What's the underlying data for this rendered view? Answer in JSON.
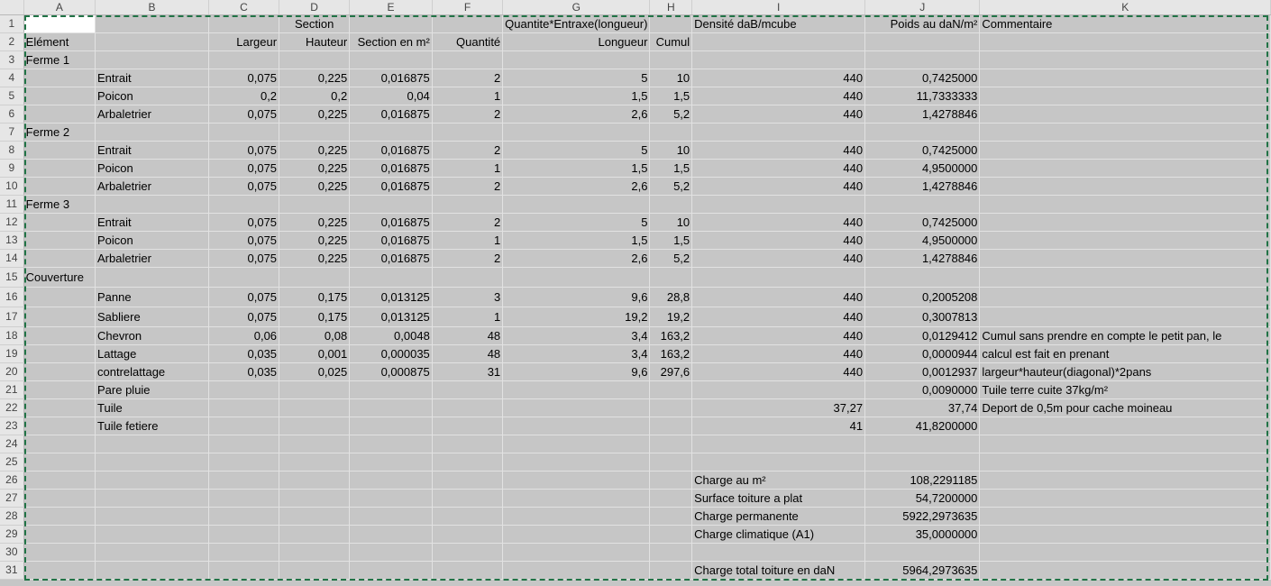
{
  "columns": [
    "A",
    "B",
    "C",
    "D",
    "E",
    "F",
    "G",
    "H",
    "I",
    "J",
    "K"
  ],
  "rows": [
    {
      "n": "1",
      "A": "",
      "B": "",
      "C": "",
      "D": "Section",
      "E": "",
      "F": "",
      "G": "Quantite*Entraxe(longueur)",
      "H": "",
      "I": "Densité daB/mcube",
      "J": "Poids au daN/m²",
      "K": "Commentaire"
    },
    {
      "n": "2",
      "A": "Elément",
      "B": "",
      "C": "Largeur",
      "D": "Hauteur",
      "E": "Section en m²",
      "F": "Quantité",
      "G": "Longueur",
      "H": "Cumul",
      "I": "",
      "J": "",
      "K": ""
    },
    {
      "n": "3",
      "A": "Ferme 1",
      "B": "",
      "C": "",
      "D": "",
      "E": "",
      "F": "",
      "G": "",
      "H": "",
      "I": "",
      "J": "",
      "K": ""
    },
    {
      "n": "4",
      "A": "",
      "B": "Entrait",
      "C": "0,075",
      "D": "0,225",
      "E": "0,016875",
      "F": "2",
      "G": "5",
      "H": "10",
      "I": "440",
      "J": "0,7425000",
      "K": ""
    },
    {
      "n": "5",
      "A": "",
      "B": "Poicon",
      "C": "0,2",
      "D": "0,2",
      "E": "0,04",
      "F": "1",
      "G": "1,5",
      "H": "1,5",
      "I": "440",
      "J": "11,7333333",
      "K": ""
    },
    {
      "n": "6",
      "A": "",
      "B": "Arbaletrier",
      "C": "0,075",
      "D": "0,225",
      "E": "0,016875",
      "F": "2",
      "G": "2,6",
      "H": "5,2",
      "I": "440",
      "J": "1,4278846",
      "K": ""
    },
    {
      "n": "7",
      "A": "Ferme 2",
      "B": "",
      "C": "",
      "D": "",
      "E": "",
      "F": "",
      "G": "",
      "H": "",
      "I": "",
      "J": "",
      "K": ""
    },
    {
      "n": "8",
      "A": "",
      "B": "Entrait",
      "C": "0,075",
      "D": "0,225",
      "E": "0,016875",
      "F": "2",
      "G": "5",
      "H": "10",
      "I": "440",
      "J": "0,7425000",
      "K": ""
    },
    {
      "n": "9",
      "A": "",
      "B": "Poicon",
      "C": "0,075",
      "D": "0,225",
      "E": "0,016875",
      "F": "1",
      "G": "1,5",
      "H": "1,5",
      "I": "440",
      "J": "4,9500000",
      "K": ""
    },
    {
      "n": "10",
      "A": "",
      "B": "Arbaletrier",
      "C": "0,075",
      "D": "0,225",
      "E": "0,016875",
      "F": "2",
      "G": "2,6",
      "H": "5,2",
      "I": "440",
      "J": "1,4278846",
      "K": ""
    },
    {
      "n": "11",
      "A": "Ferme 3",
      "B": "",
      "C": "",
      "D": "",
      "E": "",
      "F": "",
      "G": "",
      "H": "",
      "I": "",
      "J": "",
      "K": ""
    },
    {
      "n": "12",
      "A": "",
      "B": "Entrait",
      "C": "0,075",
      "D": "0,225",
      "E": "0,016875",
      "F": "2",
      "G": "5",
      "H": "10",
      "I": "440",
      "J": "0,7425000",
      "K": ""
    },
    {
      "n": "13",
      "A": "",
      "B": "Poicon",
      "C": "0,075",
      "D": "0,225",
      "E": "0,016875",
      "F": "1",
      "G": "1,5",
      "H": "1,5",
      "I": "440",
      "J": "4,9500000",
      "K": ""
    },
    {
      "n": "14",
      "A": "",
      "B": "Arbaletrier",
      "C": "0,075",
      "D": "0,225",
      "E": "0,016875",
      "F": "2",
      "G": "2,6",
      "H": "5,2",
      "I": "440",
      "J": "1,4278846",
      "K": ""
    },
    {
      "n": "15",
      "A": "Couverture",
      "B": "",
      "C": "",
      "D": "",
      "E": "",
      "F": "",
      "G": "",
      "H": "",
      "I": "",
      "J": "",
      "K": ""
    },
    {
      "n": "16",
      "A": "",
      "B": "Panne",
      "C": "0,075",
      "D": "0,175",
      "E": "0,013125",
      "F": "3",
      "G": "9,6",
      "H": "28,8",
      "I": "440",
      "J": "0,2005208",
      "K": ""
    },
    {
      "n": "17",
      "A": "",
      "B": "Sabliere",
      "C": "0,075",
      "D": "0,175",
      "E": "0,013125",
      "F": "1",
      "G": "19,2",
      "H": "19,2",
      "I": "440",
      "J": "0,3007813",
      "K": ""
    },
    {
      "n": "18",
      "A": "",
      "B": "Chevron",
      "C": "0,06",
      "D": "0,08",
      "E": "0,0048",
      "F": "48",
      "G": "3,4",
      "H": "163,2",
      "I": "440",
      "J": "0,0129412",
      "K": "Cumul sans prendre en compte le petit pan, le"
    },
    {
      "n": "19",
      "A": "",
      "B": "Lattage",
      "C": "0,035",
      "D": "0,001",
      "E": "0,000035",
      "F": "48",
      "G": "3,4",
      "H": "163,2",
      "I": "440",
      "J": "0,0000944",
      "K": "calcul est fait en prenant"
    },
    {
      "n": "20",
      "A": "",
      "B": "contrelattage",
      "C": "0,035",
      "D": "0,025",
      "E": "0,000875",
      "F": "31",
      "G": "9,6",
      "H": "297,6",
      "I": "440",
      "J": "0,0012937",
      "K": "largeur*hauteur(diagonal)*2pans"
    },
    {
      "n": "21",
      "A": "",
      "B": "Pare pluie",
      "C": "",
      "D": "",
      "E": "",
      "F": "",
      "G": "",
      "H": "",
      "I": "",
      "J": "0,0090000",
      "K": "Tuile  terre cuite 37kg/m²"
    },
    {
      "n": "22",
      "A": "",
      "B": "Tuile",
      "C": "",
      "D": "",
      "E": "",
      "F": "",
      "G": "",
      "H": "",
      "I": "37,27",
      "J": "37,74",
      "K": "Deport de 0,5m pour cache moineau"
    },
    {
      "n": "23",
      "A": "",
      "B": "Tuile fetiere",
      "C": "",
      "D": "",
      "E": "",
      "F": "",
      "G": "",
      "H": "",
      "I": "41",
      "J": "41,8200000",
      "K": ""
    },
    {
      "n": "24",
      "A": "",
      "B": "",
      "C": "",
      "D": "",
      "E": "",
      "F": "",
      "G": "",
      "H": "",
      "I": "",
      "J": "",
      "K": ""
    },
    {
      "n": "25",
      "A": "",
      "B": "",
      "C": "",
      "D": "",
      "E": "",
      "F": "",
      "G": "",
      "H": "",
      "I": "",
      "J": "",
      "K": ""
    },
    {
      "n": "26",
      "A": "",
      "B": "",
      "C": "",
      "D": "",
      "E": "",
      "F": "",
      "G": "",
      "H": "",
      "I": "Charge au m²",
      "J": "108,2291185",
      "K": ""
    },
    {
      "n": "27",
      "A": "",
      "B": "",
      "C": "",
      "D": "",
      "E": "",
      "F": "",
      "G": "",
      "H": "",
      "I": "Surface toiture a plat",
      "J": "54,7200000",
      "K": ""
    },
    {
      "n": "28",
      "A": "",
      "B": "",
      "C": "",
      "D": "",
      "E": "",
      "F": "",
      "G": "",
      "H": "",
      "I": "Charge permanente",
      "J": "5922,2973635",
      "K": ""
    },
    {
      "n": "29",
      "A": "",
      "B": "",
      "C": "",
      "D": "",
      "E": "",
      "F": "",
      "G": "",
      "H": "",
      "I": "Charge climatique (A1)",
      "J": "35,0000000",
      "K": ""
    },
    {
      "n": "30",
      "A": "",
      "B": "",
      "C": "",
      "D": "",
      "E": "",
      "F": "",
      "G": "",
      "H": "",
      "I": "",
      "J": "",
      "K": ""
    },
    {
      "n": "31",
      "A": "",
      "B": "",
      "C": "",
      "D": "",
      "E": "",
      "F": "",
      "G": "",
      "H": "",
      "I": "Charge total toiture en daN",
      "J": "5964,2973635",
      "K": ""
    }
  ]
}
